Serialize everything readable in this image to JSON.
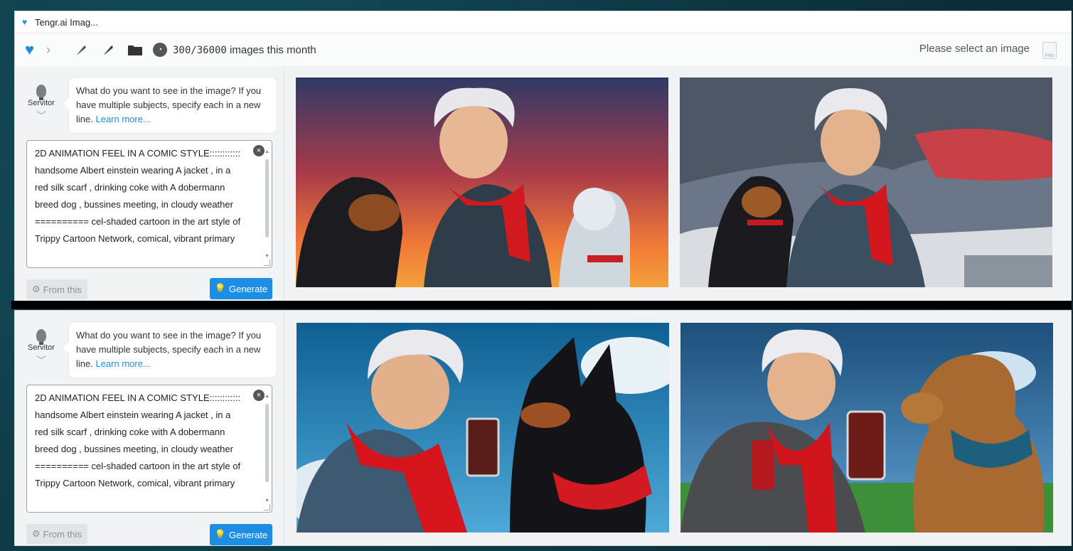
{
  "window": {
    "title": "Tengr.ai Imag..."
  },
  "toolbar": {
    "usage_count": "300/36000",
    "usage_suffix": "images this month",
    "select_message": "Please select an image",
    "png_label": "PNG"
  },
  "sidebar": {
    "assistant_name": "Servitor",
    "hint_text": "What do you want to see in the image? If you have multiple subjects, specify each in a new line.",
    "learn_more": "Learn more...",
    "prompt_value": "2D ANIMATION FEEL IN A COMIC STYLE:::::::::::: handsome Albert einstein wearing A jacket , in a red silk scarf , drinking coke with A dobermann breed dog , bussines meeting, in cloudy weather ========== cel-shaded cartoon in the art style of Trippy Cartoon Network, comical, vibrant primary",
    "from_this_label": "From this",
    "generate_label": "Generate"
  },
  "colors": {
    "accent": "#1c8fe5",
    "background": "#0e3a46"
  }
}
